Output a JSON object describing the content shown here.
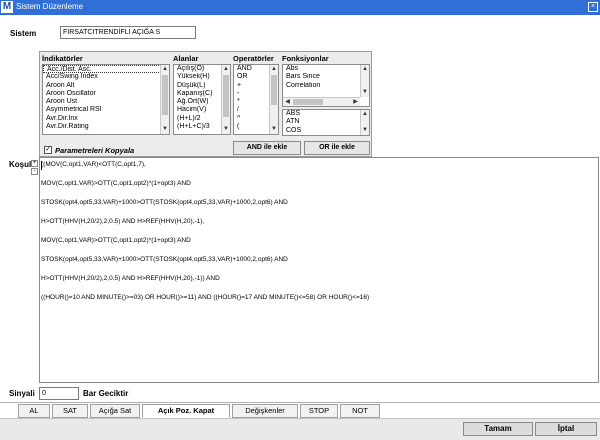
{
  "window": {
    "app_icon": "M",
    "title": "Sistem Düzenleme",
    "close_glyph": "×"
  },
  "sistem": {
    "label": "Sistem",
    "value": "FIRSATCITRENDİFLİ AÇIĞA S"
  },
  "panel": {
    "indicators": {
      "header": "İndikatörler",
      "items": [
        "Acc./Dist. Asc.",
        "Acc/Swing Index",
        "Aroon Alt",
        "Aroon Oscillator",
        "Aroon Üst",
        "Asymmetrical RSI",
        "Avr.Dir.Inx",
        "Avr.Dir.Rating"
      ]
    },
    "fields": {
      "header": "Alanlar",
      "items": [
        "Açılış(O)",
        "Yüksek(H)",
        "Düşük(L)",
        "Kapanış(C)",
        "Ağ.Ort(W)",
        "Hacim(V)",
        "(H+L)/2",
        "(H+L+C)/3"
      ]
    },
    "operators": {
      "header": "Operatörler",
      "items": [
        "AND",
        "OR",
        "+",
        "-",
        "*",
        "/",
        "^",
        "("
      ]
    },
    "functions": {
      "header": "Fonksiyonlar",
      "items": [
        "Abs",
        "Bars Since",
        "Correlation"
      ],
      "list2": [
        "ABS",
        "ATN",
        "COS"
      ]
    },
    "copy_params_label": "Parametreleri Kopyala",
    "copy_params_checked": true,
    "and_button": "AND ile ekle",
    "or_button": "OR ile ekle"
  },
  "kosul": {
    "label": "Koşul",
    "plus": "+",
    "minus": "-",
    "lines": [
      "((MOV(C,opt1,VAR)<OTT(C,opt1,7),",
      "MOV(C,opt1,VAR)>OTT(C,opt1,opt2)*(1+opt3) AND",
      "STOSK(opt4,opt5,33,VAR)+1000>OTT(STOSK(opt4,opt5,33,VAR)+1000,2,opt6) AND",
      "H>OTT(HHV(H,20/2),2,0.5) AND H>REF(HHV(H,20),-1),",
      "MOV(C,opt1,VAR)>OTT(C,opt1,opt2)*(1+opt3) AND",
      "STOSK(opt4,opt5,33,VAR)+1000>OTT(STOSK(opt4,opt5,33,VAR)+1000,2,opt6) AND",
      "H>OTT(HHV(H,20/2),2,0.5) AND H>REF(HHV(H,20),-1)) AND",
      "((HOUR()=10 AND MINUTE()>=03) OR HOUR()>=11) AND ((HOUR()=17 AND MINUTE()<=58) OR HOUR()<=16)"
    ]
  },
  "sinyali": {
    "label": "Sinyali",
    "value": "0",
    "suffix": "Bar Geciktir"
  },
  "tabs": [
    "AL",
    "SAT",
    "Açığa Sat",
    "Açık Poz. Kapat",
    "Değişkenler",
    "STOP",
    "NOT"
  ],
  "active_tab": "Açık Poz. Kapat",
  "footer": {
    "ok": "Tamam",
    "cancel": "İptal"
  }
}
